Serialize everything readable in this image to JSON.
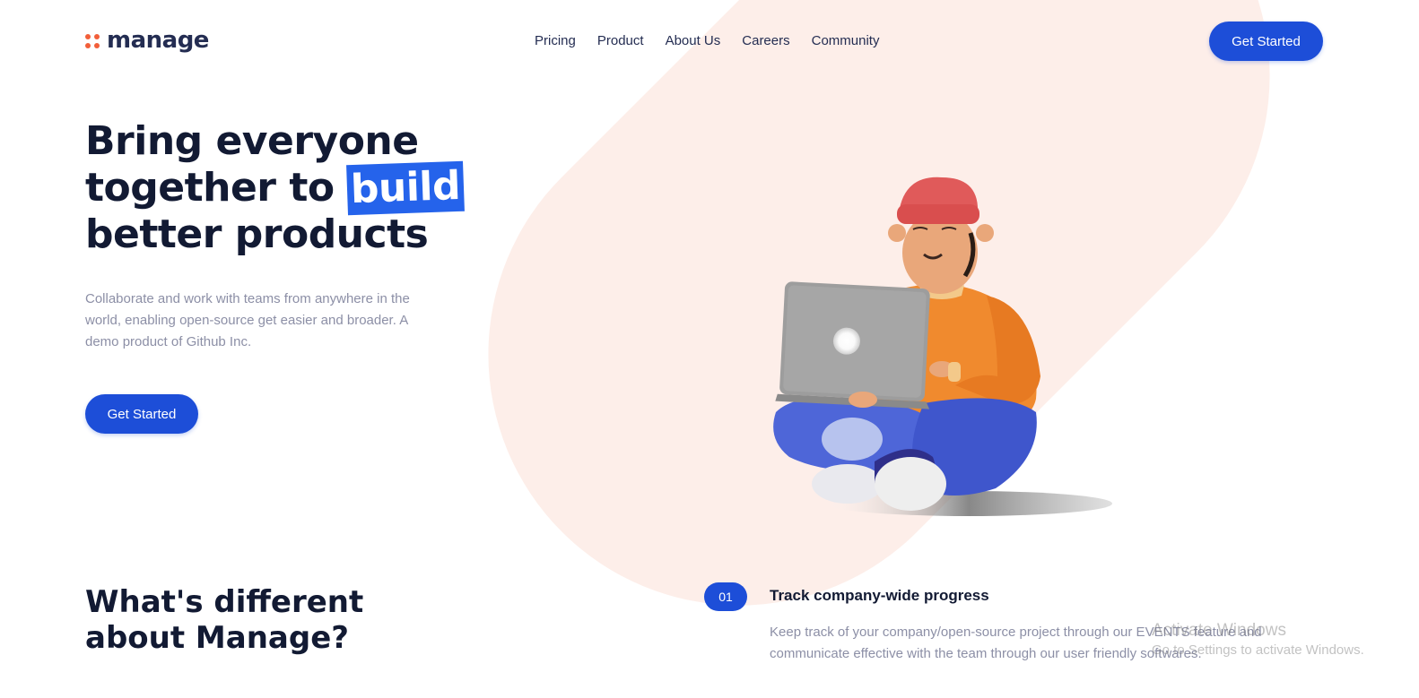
{
  "header": {
    "logo": "manage",
    "nav": [
      "Pricing",
      "Product",
      "About Us",
      "Careers",
      "Community"
    ],
    "cta": "Get Started"
  },
  "hero": {
    "title_line1": "Bring everyone",
    "title_line2_pre": "together to ",
    "title_highlight": "build",
    "title_line3": "better products",
    "description": "Collaborate and work with teams from anywhere in the world, enabling open-source get easier and broader. A demo product of Github Inc.",
    "cta": "Get Started"
  },
  "features": {
    "title": "What's different about Manage?",
    "items": [
      {
        "number": "01",
        "heading": "Track company-wide progress",
        "description": "Keep track of your company/open-source project through our EVENTS feature and communicate effective with the team through our user friendly softwares."
      }
    ]
  },
  "watermark": {
    "line1": "Activate Windows",
    "line2": "Go to Settings to activate Windows."
  },
  "colors": {
    "primary": "#1d4ed8",
    "highlight": "#2563eb",
    "logo_dots": "#f25f3a",
    "swoosh": "#fdeee9",
    "heading": "#121a33",
    "muted": "#8c8fa6"
  }
}
